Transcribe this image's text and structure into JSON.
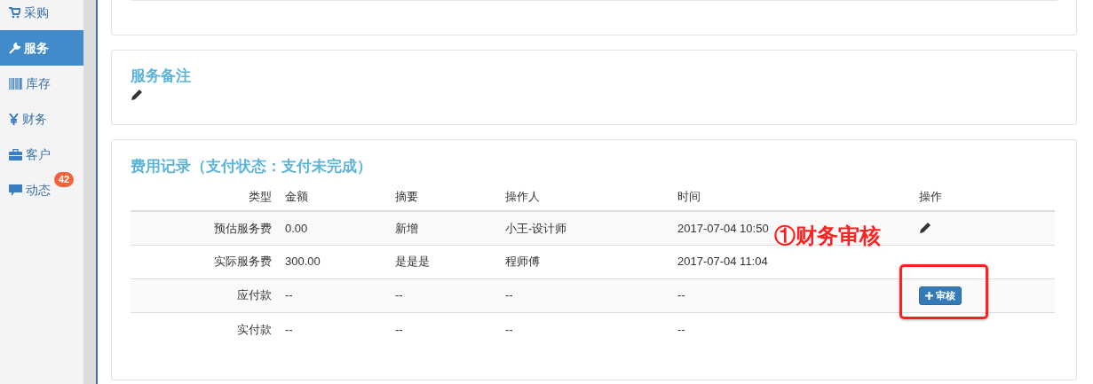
{
  "sidebar": {
    "items": [
      {
        "label": "采购",
        "kind": "cart",
        "selected": false
      },
      {
        "label": "服务",
        "kind": "wrench",
        "selected": true
      },
      {
        "label": "库存",
        "kind": "barcode",
        "selected": false
      },
      {
        "label": "财务",
        "kind": "yen",
        "selected": false
      },
      {
        "label": "客户",
        "kind": "briefcase",
        "selected": false
      },
      {
        "label": "动态",
        "kind": "comment",
        "selected": false,
        "badge": "42"
      }
    ]
  },
  "service_notes": {
    "title": "服务备注"
  },
  "fee_records": {
    "title": "费用记录（支付状态：支付未完成）",
    "columns": [
      "类型",
      "金额",
      "摘要",
      "操作人",
      "时间",
      "操作"
    ],
    "rows": [
      {
        "type": "预估服务费",
        "amount": "0.00",
        "summary": "新增",
        "operator": "小王-设计师",
        "time": "2017-07-04 10:50",
        "action": {
          "kind": "edit"
        }
      },
      {
        "type": "实际服务费",
        "amount": "300.00",
        "summary": "是是是",
        "operator": "程师傅",
        "time": "2017-07-04 11:04"
      },
      {
        "type": "应付款",
        "amount": "--",
        "summary": "--",
        "operator": "--",
        "time": "--",
        "action": {
          "kind": "button",
          "label": "审核"
        }
      },
      {
        "type": "实付款",
        "amount": "--",
        "summary": "--",
        "operator": "--",
        "time": "--"
      }
    ]
  },
  "annotation": {
    "text": "①财务审核"
  }
}
